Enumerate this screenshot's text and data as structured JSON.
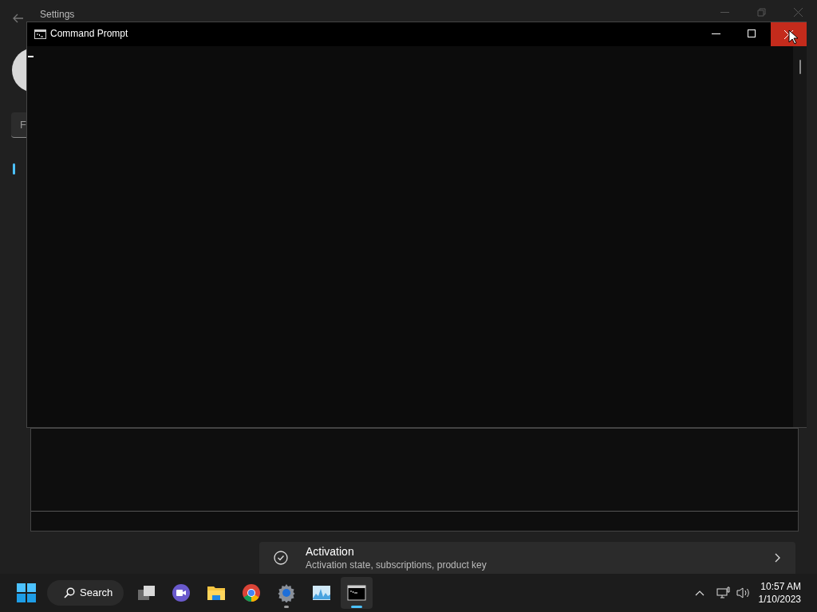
{
  "settings_window": {
    "title": "Settings",
    "search": {
      "placeholder": "F"
    },
    "activation_card": {
      "title": "Activation",
      "subtitle": "Activation state, subscriptions, product key"
    }
  },
  "console_window": {
    "title": "Command Prompt"
  },
  "taskbar": {
    "search_label": "Search",
    "apps": [
      {
        "kind": "taskview",
        "running": false,
        "selected": false
      },
      {
        "kind": "chat",
        "running": false,
        "selected": false
      },
      {
        "kind": "folder",
        "running": false,
        "selected": false
      },
      {
        "kind": "browser",
        "running": false,
        "selected": false
      },
      {
        "kind": "gear",
        "running": true,
        "selected": false
      },
      {
        "kind": "monitor",
        "running": false,
        "selected": false
      },
      {
        "kind": "terminal",
        "running": true,
        "selected": true
      }
    ],
    "time": "10:57 AM",
    "date": "1/10/2023"
  }
}
